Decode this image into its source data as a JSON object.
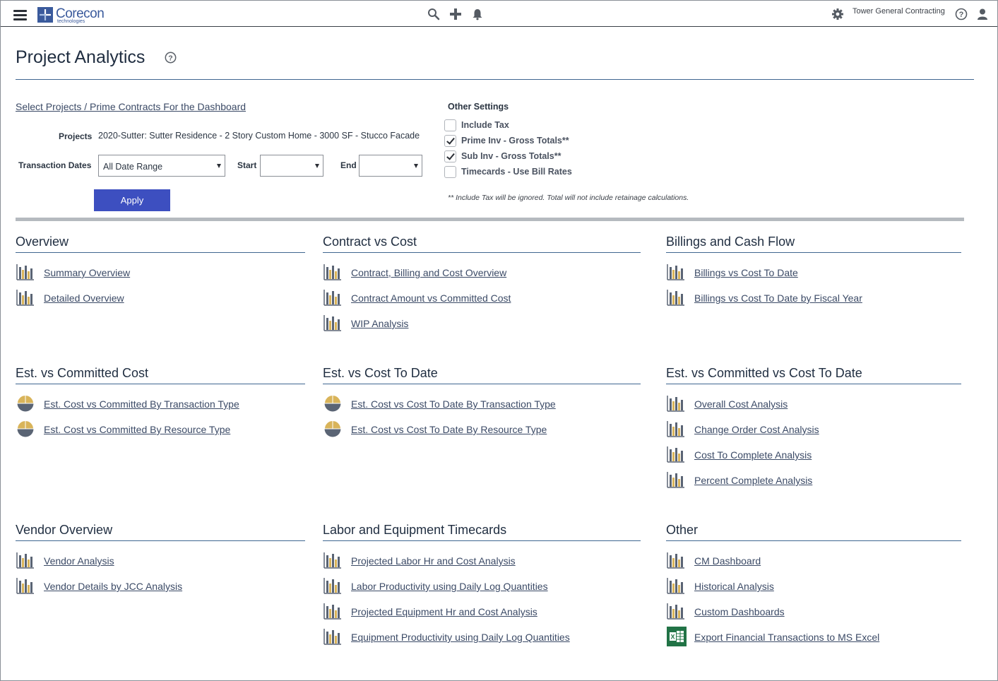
{
  "header": {
    "logo_name": "Corecon",
    "logo_sub": "technologies",
    "company": "Tower General Contracting"
  },
  "page": {
    "title": "Project Analytics"
  },
  "settings": {
    "select_link": "Select Projects / Prime Contracts For the Dashboard",
    "projects_label": "Projects",
    "projects_value": "2020-Sutter: Sutter Residence - 2 Story Custom Home - 3000 SF - Stucco Facade",
    "dates_label": "Transaction Dates",
    "dates_value": "All Date Range",
    "start_label": "Start",
    "start_value": "",
    "end_label": "End",
    "end_value": "",
    "apply_label": "Apply"
  },
  "other_settings": {
    "title": "Other Settings",
    "options": [
      {
        "label": "Include Tax",
        "checked": false
      },
      {
        "label": "Prime Inv - Gross Totals**",
        "checked": true
      },
      {
        "label": "Sub Inv - Gross Totals**",
        "checked": true
      },
      {
        "label": "Timecards - Use Bill Rates",
        "checked": false
      }
    ],
    "note": "** Include Tax will be ignored. Total will not include retainage calculations."
  },
  "sections": {
    "overview": {
      "title": "Overview",
      "links": [
        {
          "label": "Summary Overview",
          "icon": "bar-chart-icon"
        },
        {
          "label": "Detailed Overview",
          "icon": "bar-chart-icon"
        }
      ]
    },
    "contract_cost": {
      "title": "Contract vs Cost",
      "links": [
        {
          "label": "Contract, Billing and Cost Overview",
          "icon": "bar-chart-icon"
        },
        {
          "label": "Contract Amount vs Committed Cost",
          "icon": "bar-chart-icon"
        },
        {
          "label": "WIP Analysis",
          "icon": "bar-chart-icon"
        }
      ]
    },
    "billings": {
      "title": "Billings and Cash Flow",
      "links": [
        {
          "label": "Billings vs Cost To Date",
          "icon": "bar-chart-icon"
        },
        {
          "label": "Billings vs Cost To Date by Fiscal Year",
          "icon": "bar-chart-icon"
        }
      ]
    },
    "est_committed": {
      "title": "Est. vs Committed Cost",
      "links": [
        {
          "label": "Est. Cost vs Committed By Transaction Type",
          "icon": "pie-chart-icon"
        },
        {
          "label": "Est. Cost vs Committed By Resource Type",
          "icon": "pie-chart-icon"
        }
      ]
    },
    "est_ctd": {
      "title": "Est. vs Cost To Date",
      "links": [
        {
          "label": "Est. Cost vs Cost To Date By Transaction Type",
          "icon": "pie-chart-icon"
        },
        {
          "label": "Est. Cost vs Cost To Date By Resource Type",
          "icon": "pie-chart-icon"
        }
      ]
    },
    "est_committed_ctd": {
      "title": "Est. vs Committed vs Cost To Date",
      "links": [
        {
          "label": "Overall Cost Analysis",
          "icon": "bar-chart-icon"
        },
        {
          "label": "Change Order Cost Analysis",
          "icon": "bar-chart-icon"
        },
        {
          "label": "Cost To Complete Analysis",
          "icon": "bar-chart-icon"
        },
        {
          "label": "Percent Complete Analysis",
          "icon": "bar-chart-icon"
        }
      ]
    },
    "vendor": {
      "title": "Vendor Overview",
      "links": [
        {
          "label": "Vendor Analysis",
          "icon": "bar-chart-icon"
        },
        {
          "label": "Vendor Details by JCC Analysis",
          "icon": "bar-chart-icon"
        }
      ]
    },
    "labor": {
      "title": "Labor and Equipment Timecards",
      "links": [
        {
          "label": "Projected Labor Hr and Cost Analysis",
          "icon": "bar-chart-icon"
        },
        {
          "label": "Labor Productivity using Daily Log Quantities",
          "icon": "bar-chart-icon"
        },
        {
          "label": "Projected Equipment Hr and Cost Analysis",
          "icon": "bar-chart-icon"
        },
        {
          "label": "Equipment Productivity using Daily Log Quantities",
          "icon": "bar-chart-icon"
        }
      ]
    },
    "other": {
      "title": "Other",
      "links": [
        {
          "label": "CM Dashboard",
          "icon": "bar-chart-icon"
        },
        {
          "label": "Historical Analysis",
          "icon": "bar-chart-icon"
        },
        {
          "label": "Custom Dashboards",
          "icon": "bar-chart-icon"
        },
        {
          "label": "Export Financial Transactions to MS Excel",
          "icon": "excel-icon"
        }
      ]
    }
  },
  "colors": {
    "accent_blue": "#3d4fc0",
    "rule_blue": "#3f6690",
    "link": "#3b4a66",
    "bar_gold": "#d9b45a",
    "bar_slate": "#5a6474",
    "excel_green": "#217346"
  }
}
